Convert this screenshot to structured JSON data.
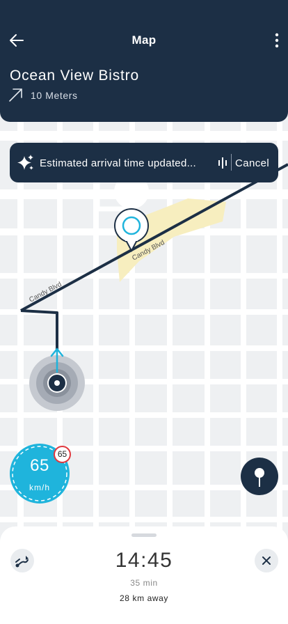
{
  "header": {
    "title": "Map",
    "destination": "Ocean View Bistro",
    "distance": "10 Meters",
    "icons": {
      "back": "arrow-left-icon",
      "more": "more-vertical-icon",
      "turn": "arrow-up-right-icon"
    }
  },
  "notification": {
    "text": "Estimated arrival time updated...",
    "cancel_label": "Cancel",
    "icons": {
      "sparkle": "sparkle-icon",
      "audio": "audio-wave-icon"
    }
  },
  "map": {
    "street_labels": [
      "Candy Blvd",
      "Candy Blvd"
    ],
    "route_color": "#1c2f45",
    "accent_color": "#1fb4dc"
  },
  "speed": {
    "value": "65",
    "unit": "km/h",
    "limit": "65"
  },
  "bottom_sheet": {
    "eta": "14:45",
    "duration": "35 min",
    "distance_away": "28 km away",
    "icons": {
      "route": "route-icon",
      "close": "close-icon"
    }
  },
  "pin_button": {
    "icon": "map-pin-icon"
  }
}
